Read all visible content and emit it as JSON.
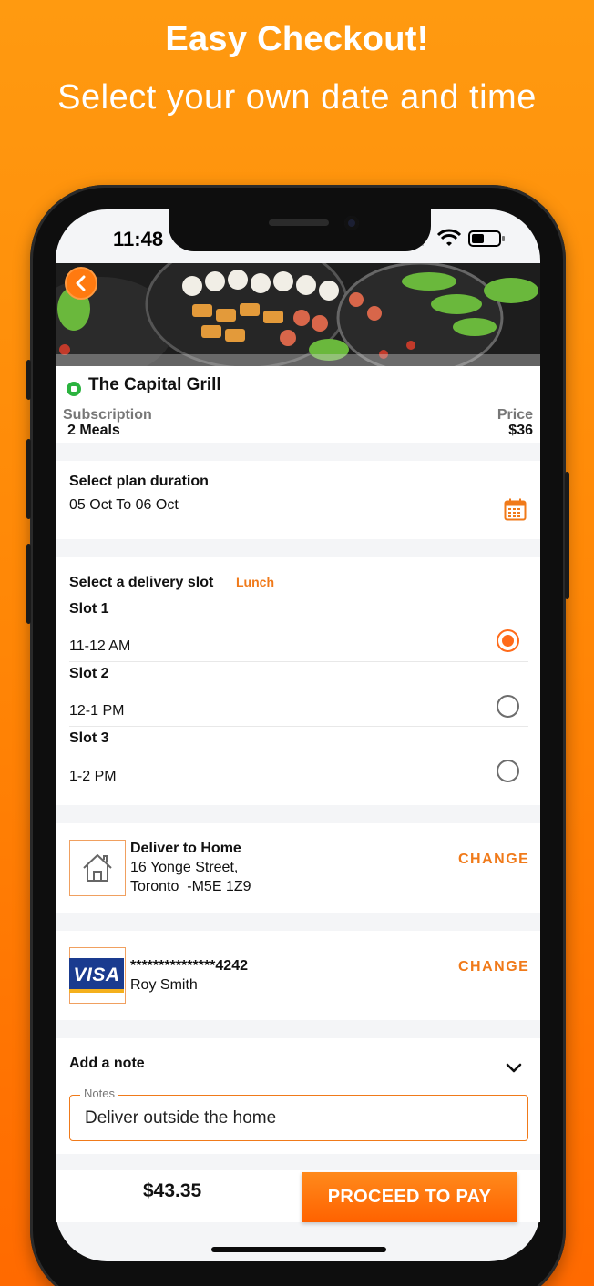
{
  "hero": {
    "title": "Easy Checkout!",
    "subtitle": "Select your own date and time"
  },
  "status_bar": {
    "time": "11:48"
  },
  "restaurant": {
    "name": "The Capital Grill",
    "status_color": "#2bb33f",
    "subscription_label": "Subscription",
    "subscription_value": "2 Meals",
    "price_label": "Price",
    "price_value": "$36"
  },
  "plan_duration": {
    "title": "Select plan duration",
    "value": "05 Oct To 06 Oct",
    "icon": "calendar-icon"
  },
  "delivery_slot": {
    "title": "Select a delivery slot",
    "meal_tag": "Lunch",
    "slots": [
      {
        "name": "Slot 1",
        "time": "11-12 AM",
        "selected": true
      },
      {
        "name": "Slot 2",
        "time": "12-1 PM",
        "selected": false
      },
      {
        "name": "Slot 3",
        "time": "1-2 PM",
        "selected": false
      }
    ]
  },
  "address": {
    "title": "Deliver to Home",
    "line1": "16 Yonge Street,",
    "line2": "Toronto  -M5E 1Z9",
    "change_label": "CHANGE",
    "icon": "home-icon"
  },
  "payment": {
    "card_brand": "VISA",
    "card_number": "***************4242",
    "card_holder": "Roy Smith",
    "change_label": "CHANGE"
  },
  "note": {
    "title": "Add a note",
    "legend": "Notes",
    "value": "Deliver outside the home"
  },
  "footer": {
    "total": "$43.35",
    "pay_label": "PROCEED TO PAY"
  },
  "colors": {
    "accent": "#f07a1a",
    "background": "#ff8606"
  }
}
